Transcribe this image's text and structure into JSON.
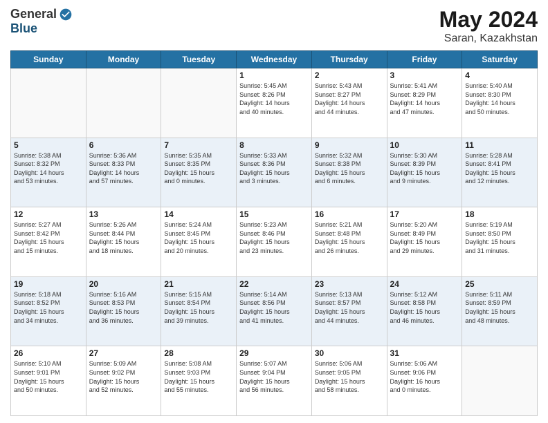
{
  "logo": {
    "general": "General",
    "blue": "Blue"
  },
  "title": {
    "month_year": "May 2024",
    "location": "Saran, Kazakhstan"
  },
  "days_of_week": [
    "Sunday",
    "Monday",
    "Tuesday",
    "Wednesday",
    "Thursday",
    "Friday",
    "Saturday"
  ],
  "weeks": [
    [
      {
        "day": "",
        "info": ""
      },
      {
        "day": "",
        "info": ""
      },
      {
        "day": "",
        "info": ""
      },
      {
        "day": "1",
        "info": "Sunrise: 5:45 AM\nSunset: 8:26 PM\nDaylight: 14 hours\nand 40 minutes."
      },
      {
        "day": "2",
        "info": "Sunrise: 5:43 AM\nSunset: 8:27 PM\nDaylight: 14 hours\nand 44 minutes."
      },
      {
        "day": "3",
        "info": "Sunrise: 5:41 AM\nSunset: 8:29 PM\nDaylight: 14 hours\nand 47 minutes."
      },
      {
        "day": "4",
        "info": "Sunrise: 5:40 AM\nSunset: 8:30 PM\nDaylight: 14 hours\nand 50 minutes."
      }
    ],
    [
      {
        "day": "5",
        "info": "Sunrise: 5:38 AM\nSunset: 8:32 PM\nDaylight: 14 hours\nand 53 minutes."
      },
      {
        "day": "6",
        "info": "Sunrise: 5:36 AM\nSunset: 8:33 PM\nDaylight: 14 hours\nand 57 minutes."
      },
      {
        "day": "7",
        "info": "Sunrise: 5:35 AM\nSunset: 8:35 PM\nDaylight: 15 hours\nand 0 minutes."
      },
      {
        "day": "8",
        "info": "Sunrise: 5:33 AM\nSunset: 8:36 PM\nDaylight: 15 hours\nand 3 minutes."
      },
      {
        "day": "9",
        "info": "Sunrise: 5:32 AM\nSunset: 8:38 PM\nDaylight: 15 hours\nand 6 minutes."
      },
      {
        "day": "10",
        "info": "Sunrise: 5:30 AM\nSunset: 8:39 PM\nDaylight: 15 hours\nand 9 minutes."
      },
      {
        "day": "11",
        "info": "Sunrise: 5:28 AM\nSunset: 8:41 PM\nDaylight: 15 hours\nand 12 minutes."
      }
    ],
    [
      {
        "day": "12",
        "info": "Sunrise: 5:27 AM\nSunset: 8:42 PM\nDaylight: 15 hours\nand 15 minutes."
      },
      {
        "day": "13",
        "info": "Sunrise: 5:26 AM\nSunset: 8:44 PM\nDaylight: 15 hours\nand 18 minutes."
      },
      {
        "day": "14",
        "info": "Sunrise: 5:24 AM\nSunset: 8:45 PM\nDaylight: 15 hours\nand 20 minutes."
      },
      {
        "day": "15",
        "info": "Sunrise: 5:23 AM\nSunset: 8:46 PM\nDaylight: 15 hours\nand 23 minutes."
      },
      {
        "day": "16",
        "info": "Sunrise: 5:21 AM\nSunset: 8:48 PM\nDaylight: 15 hours\nand 26 minutes."
      },
      {
        "day": "17",
        "info": "Sunrise: 5:20 AM\nSunset: 8:49 PM\nDaylight: 15 hours\nand 29 minutes."
      },
      {
        "day": "18",
        "info": "Sunrise: 5:19 AM\nSunset: 8:50 PM\nDaylight: 15 hours\nand 31 minutes."
      }
    ],
    [
      {
        "day": "19",
        "info": "Sunrise: 5:18 AM\nSunset: 8:52 PM\nDaylight: 15 hours\nand 34 minutes."
      },
      {
        "day": "20",
        "info": "Sunrise: 5:16 AM\nSunset: 8:53 PM\nDaylight: 15 hours\nand 36 minutes."
      },
      {
        "day": "21",
        "info": "Sunrise: 5:15 AM\nSunset: 8:54 PM\nDaylight: 15 hours\nand 39 minutes."
      },
      {
        "day": "22",
        "info": "Sunrise: 5:14 AM\nSunset: 8:56 PM\nDaylight: 15 hours\nand 41 minutes."
      },
      {
        "day": "23",
        "info": "Sunrise: 5:13 AM\nSunset: 8:57 PM\nDaylight: 15 hours\nand 44 minutes."
      },
      {
        "day": "24",
        "info": "Sunrise: 5:12 AM\nSunset: 8:58 PM\nDaylight: 15 hours\nand 46 minutes."
      },
      {
        "day": "25",
        "info": "Sunrise: 5:11 AM\nSunset: 8:59 PM\nDaylight: 15 hours\nand 48 minutes."
      }
    ],
    [
      {
        "day": "26",
        "info": "Sunrise: 5:10 AM\nSunset: 9:01 PM\nDaylight: 15 hours\nand 50 minutes."
      },
      {
        "day": "27",
        "info": "Sunrise: 5:09 AM\nSunset: 9:02 PM\nDaylight: 15 hours\nand 52 minutes."
      },
      {
        "day": "28",
        "info": "Sunrise: 5:08 AM\nSunset: 9:03 PM\nDaylight: 15 hours\nand 55 minutes."
      },
      {
        "day": "29",
        "info": "Sunrise: 5:07 AM\nSunset: 9:04 PM\nDaylight: 15 hours\nand 56 minutes."
      },
      {
        "day": "30",
        "info": "Sunrise: 5:06 AM\nSunset: 9:05 PM\nDaylight: 15 hours\nand 58 minutes."
      },
      {
        "day": "31",
        "info": "Sunrise: 5:06 AM\nSunset: 9:06 PM\nDaylight: 16 hours\nand 0 minutes."
      },
      {
        "day": "",
        "info": ""
      }
    ]
  ]
}
